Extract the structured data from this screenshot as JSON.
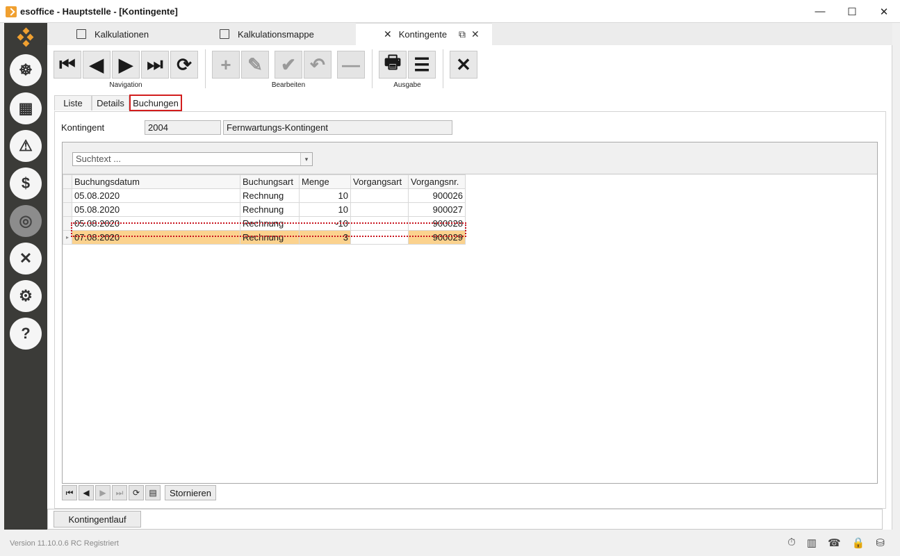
{
  "window": {
    "title": "esoffice - Hauptstelle - [Kontingente]",
    "minimize": "—",
    "maximize": "☐",
    "close": "✕"
  },
  "doc_tabs": [
    {
      "label": "Kalkulationen"
    },
    {
      "label": "Kalkulationsmappe"
    },
    {
      "label": "Kontingente"
    }
  ],
  "doc_tab_tools": {
    "popout": "⧉",
    "close": "✕"
  },
  "toolbar": {
    "groups": {
      "navigation": "Navigation",
      "bearbeiten": "Bearbeiten",
      "ausgabe": "Ausgabe"
    },
    "icons": {
      "first": "⏮",
      "prev": "◀",
      "next": "▶",
      "last": "⏭",
      "refresh": "⟳",
      "add": "+",
      "edit": "✎",
      "save": "✔",
      "undo": "↶",
      "remove": "—",
      "print": "🖶",
      "export": "☰",
      "close": "✕"
    }
  },
  "inner_tabs": [
    {
      "label": "Liste"
    },
    {
      "label": "Details"
    },
    {
      "label": "Buchungen"
    }
  ],
  "contingent": {
    "label": "Kontingent",
    "number": "2004",
    "name": "Fernwartungs-Kontingent"
  },
  "search": {
    "placeholder": "Suchtext ...",
    "dropdown": "▾"
  },
  "grid": {
    "columns": [
      "Buchungsdatum",
      "Buchungsart",
      "Menge",
      "Vorgangsart",
      "Vorgangsnr."
    ],
    "rows": [
      {
        "datum": "05.08.2020",
        "art": "Rechnung",
        "menge": "10",
        "vorgangsart": "",
        "nr": "900026"
      },
      {
        "datum": "05.08.2020",
        "art": "Rechnung",
        "menge": "10",
        "vorgangsart": "",
        "nr": "900027"
      },
      {
        "datum": "05.08.2020",
        "art": "Rechnung",
        "menge": "-10",
        "vorgangsart": "",
        "nr": "900028"
      },
      {
        "datum": "07.08.2020",
        "art": "Rechnung",
        "menge": "3",
        "vorgangsart": "",
        "nr": "900029"
      }
    ],
    "row_indicator": "▸"
  },
  "grid_nav": {
    "first": "⏮",
    "prev": "◀",
    "next": "▶",
    "last": "⏭",
    "refresh": "⟳",
    "export": "▤",
    "stornieren": "Stornieren"
  },
  "bottom": {
    "kontingentlauf": "Kontingentlauf"
  },
  "sidebar": {
    "icons": {
      "wheel": "☸",
      "plan": "▦",
      "alarm": "⚠",
      "money": "$",
      "support": "◎",
      "tools": "✕",
      "settings": "⚙",
      "help": "?"
    }
  },
  "status": {
    "version": "Version 11.10.0.6 RC     Registriert",
    "icons": {
      "timer": "⏱",
      "building": "▥",
      "phone": "☎",
      "lock": "🔒",
      "db": "⛁"
    }
  },
  "colors": {
    "accent": "#f0a030",
    "selection": "#fbd28e",
    "highlight_border": "#d21d1d",
    "sidebar": "#3b3b38"
  }
}
